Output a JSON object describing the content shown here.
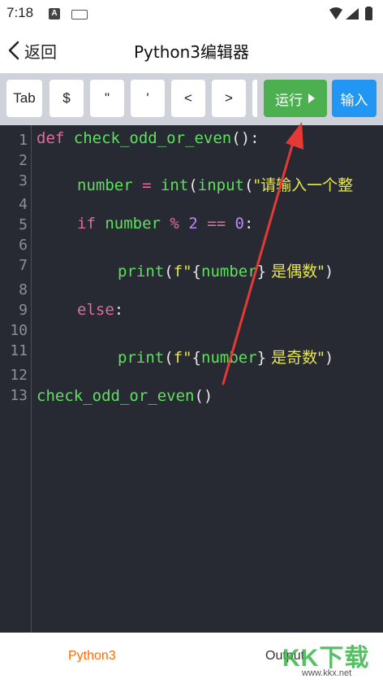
{
  "status_bar": {
    "time": "7:18",
    "notification_letter": "A"
  },
  "nav": {
    "back_label": "返回",
    "title": "Python3编辑器"
  },
  "toolbar": {
    "keys": [
      "Tab",
      "$",
      "\"",
      "'",
      "<",
      ">"
    ],
    "run_label": "运行",
    "input_label": "输入"
  },
  "editor": {
    "line_numbers": [
      "1",
      "2",
      "3",
      "4",
      "5",
      "6",
      "7",
      "8",
      "9",
      "10",
      "11",
      "12",
      "13"
    ],
    "lines": {
      "l1": {
        "kw": "def",
        "fn": "check_odd_or_even",
        "pn": "():"
      },
      "l3": {
        "var": "number",
        "op": " = ",
        "fn": "int",
        "p1": "(",
        "fn2": "input",
        "p2": "(",
        "str": "\"请输入一个整"
      },
      "l5": {
        "kw": "if",
        "var": "number",
        "op1": " % ",
        "num1": "2",
        "op2": " == ",
        "num2": "0",
        "pn": ":"
      },
      "l7": {
        "fn": "print",
        "p1": "(",
        "s1": "f\"",
        "b1": "{",
        "var": "number",
        "b2": "}",
        "s2": " 是偶数\"",
        "p2": ")"
      },
      "l9": {
        "kw": "else",
        "pn": ":"
      },
      "l11": {
        "fn": "print",
        "p1": "(",
        "s1": "f\"",
        "b1": "{",
        "var": "number",
        "b2": "}",
        "s2": " 是奇数\"",
        "p2": ")"
      },
      "l13": {
        "fn": "check_odd_or_even",
        "pn": "()"
      }
    }
  },
  "bottom_tabs": {
    "python": "Python3",
    "output": "Output"
  },
  "watermark": {
    "text": "KK下载",
    "url": "www.kkx.net"
  },
  "colors": {
    "run_button": "#4caf50",
    "input_button": "#2196f3",
    "active_tab": "#ff6a00",
    "editor_bg": "#272a33",
    "annotation_arrow": "#e53935"
  }
}
